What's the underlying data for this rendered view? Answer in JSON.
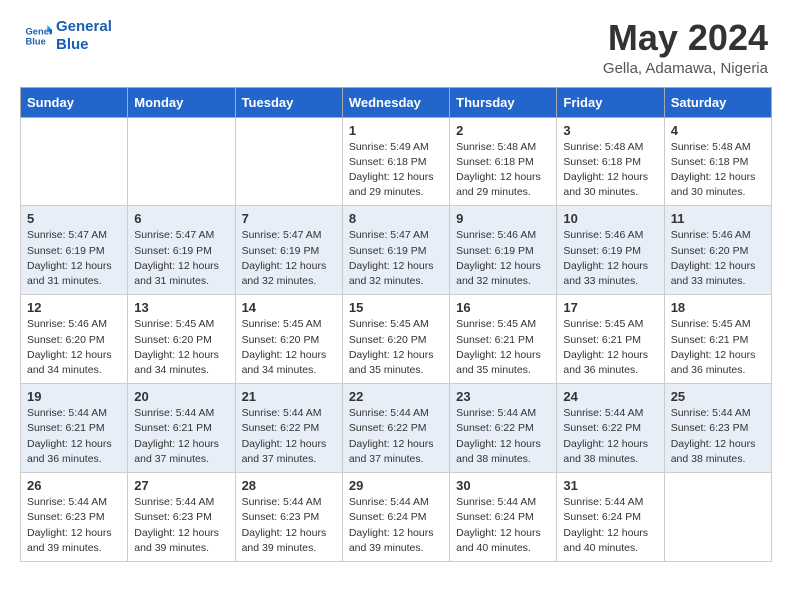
{
  "header": {
    "logo_line1": "General",
    "logo_line2": "Blue",
    "month_title": "May 2024",
    "location": "Gella, Adamawa, Nigeria"
  },
  "days_of_week": [
    "Sunday",
    "Monday",
    "Tuesday",
    "Wednesday",
    "Thursday",
    "Friday",
    "Saturday"
  ],
  "weeks": [
    [
      {
        "day": "",
        "info": ""
      },
      {
        "day": "",
        "info": ""
      },
      {
        "day": "",
        "info": ""
      },
      {
        "day": "1",
        "info": "Sunrise: 5:49 AM\nSunset: 6:18 PM\nDaylight: 12 hours\nand 29 minutes."
      },
      {
        "day": "2",
        "info": "Sunrise: 5:48 AM\nSunset: 6:18 PM\nDaylight: 12 hours\nand 29 minutes."
      },
      {
        "day": "3",
        "info": "Sunrise: 5:48 AM\nSunset: 6:18 PM\nDaylight: 12 hours\nand 30 minutes."
      },
      {
        "day": "4",
        "info": "Sunrise: 5:48 AM\nSunset: 6:18 PM\nDaylight: 12 hours\nand 30 minutes."
      }
    ],
    [
      {
        "day": "5",
        "info": "Sunrise: 5:47 AM\nSunset: 6:19 PM\nDaylight: 12 hours\nand 31 minutes."
      },
      {
        "day": "6",
        "info": "Sunrise: 5:47 AM\nSunset: 6:19 PM\nDaylight: 12 hours\nand 31 minutes."
      },
      {
        "day": "7",
        "info": "Sunrise: 5:47 AM\nSunset: 6:19 PM\nDaylight: 12 hours\nand 32 minutes."
      },
      {
        "day": "8",
        "info": "Sunrise: 5:47 AM\nSunset: 6:19 PM\nDaylight: 12 hours\nand 32 minutes."
      },
      {
        "day": "9",
        "info": "Sunrise: 5:46 AM\nSunset: 6:19 PM\nDaylight: 12 hours\nand 32 minutes."
      },
      {
        "day": "10",
        "info": "Sunrise: 5:46 AM\nSunset: 6:19 PM\nDaylight: 12 hours\nand 33 minutes."
      },
      {
        "day": "11",
        "info": "Sunrise: 5:46 AM\nSunset: 6:20 PM\nDaylight: 12 hours\nand 33 minutes."
      }
    ],
    [
      {
        "day": "12",
        "info": "Sunrise: 5:46 AM\nSunset: 6:20 PM\nDaylight: 12 hours\nand 34 minutes."
      },
      {
        "day": "13",
        "info": "Sunrise: 5:45 AM\nSunset: 6:20 PM\nDaylight: 12 hours\nand 34 minutes."
      },
      {
        "day": "14",
        "info": "Sunrise: 5:45 AM\nSunset: 6:20 PM\nDaylight: 12 hours\nand 34 minutes."
      },
      {
        "day": "15",
        "info": "Sunrise: 5:45 AM\nSunset: 6:20 PM\nDaylight: 12 hours\nand 35 minutes."
      },
      {
        "day": "16",
        "info": "Sunrise: 5:45 AM\nSunset: 6:21 PM\nDaylight: 12 hours\nand 35 minutes."
      },
      {
        "day": "17",
        "info": "Sunrise: 5:45 AM\nSunset: 6:21 PM\nDaylight: 12 hours\nand 36 minutes."
      },
      {
        "day": "18",
        "info": "Sunrise: 5:45 AM\nSunset: 6:21 PM\nDaylight: 12 hours\nand 36 minutes."
      }
    ],
    [
      {
        "day": "19",
        "info": "Sunrise: 5:44 AM\nSunset: 6:21 PM\nDaylight: 12 hours\nand 36 minutes."
      },
      {
        "day": "20",
        "info": "Sunrise: 5:44 AM\nSunset: 6:21 PM\nDaylight: 12 hours\nand 37 minutes."
      },
      {
        "day": "21",
        "info": "Sunrise: 5:44 AM\nSunset: 6:22 PM\nDaylight: 12 hours\nand 37 minutes."
      },
      {
        "day": "22",
        "info": "Sunrise: 5:44 AM\nSunset: 6:22 PM\nDaylight: 12 hours\nand 37 minutes."
      },
      {
        "day": "23",
        "info": "Sunrise: 5:44 AM\nSunset: 6:22 PM\nDaylight: 12 hours\nand 38 minutes."
      },
      {
        "day": "24",
        "info": "Sunrise: 5:44 AM\nSunset: 6:22 PM\nDaylight: 12 hours\nand 38 minutes."
      },
      {
        "day": "25",
        "info": "Sunrise: 5:44 AM\nSunset: 6:23 PM\nDaylight: 12 hours\nand 38 minutes."
      }
    ],
    [
      {
        "day": "26",
        "info": "Sunrise: 5:44 AM\nSunset: 6:23 PM\nDaylight: 12 hours\nand 39 minutes."
      },
      {
        "day": "27",
        "info": "Sunrise: 5:44 AM\nSunset: 6:23 PM\nDaylight: 12 hours\nand 39 minutes."
      },
      {
        "day": "28",
        "info": "Sunrise: 5:44 AM\nSunset: 6:23 PM\nDaylight: 12 hours\nand 39 minutes."
      },
      {
        "day": "29",
        "info": "Sunrise: 5:44 AM\nSunset: 6:24 PM\nDaylight: 12 hours\nand 39 minutes."
      },
      {
        "day": "30",
        "info": "Sunrise: 5:44 AM\nSunset: 6:24 PM\nDaylight: 12 hours\nand 40 minutes."
      },
      {
        "day": "31",
        "info": "Sunrise: 5:44 AM\nSunset: 6:24 PM\nDaylight: 12 hours\nand 40 minutes."
      },
      {
        "day": "",
        "info": ""
      }
    ]
  ]
}
